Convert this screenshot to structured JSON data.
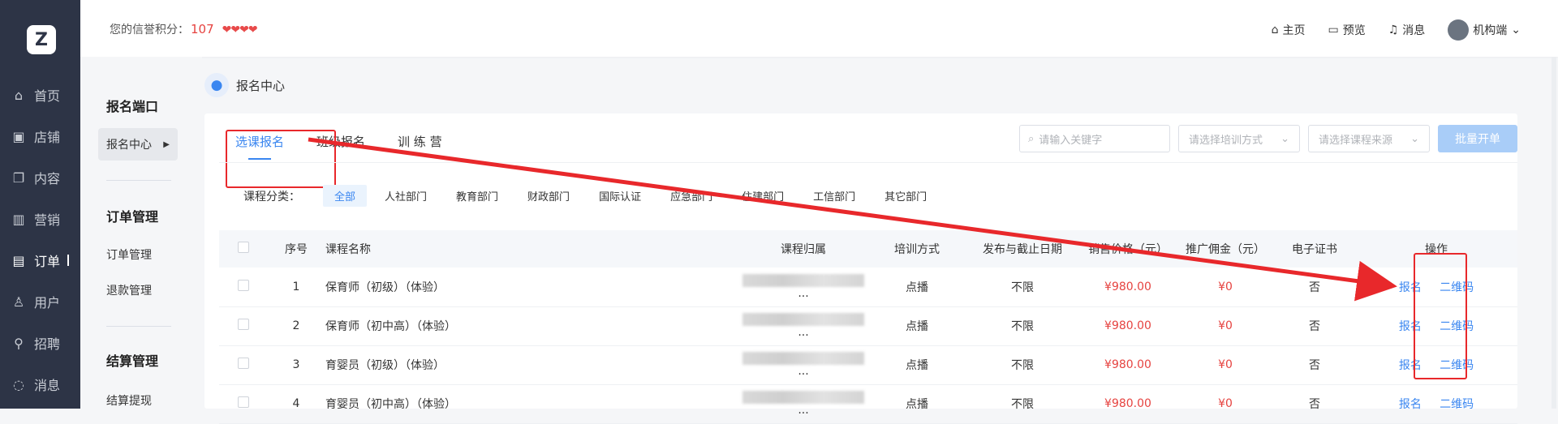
{
  "nav": {
    "logo": "Z",
    "items": [
      {
        "label": "首页",
        "icon": "⌂"
      },
      {
        "label": "店铺",
        "icon": "▣"
      },
      {
        "label": "内容",
        "icon": "❐"
      },
      {
        "label": "营销",
        "icon": "▥"
      },
      {
        "label": "订单",
        "icon": "▤"
      },
      {
        "label": "用户",
        "icon": "♙"
      },
      {
        "label": "招聘",
        "icon": "⚲"
      },
      {
        "label": "消息",
        "icon": "◌"
      }
    ]
  },
  "header": {
    "credit_label": "您的信誉积分：",
    "credit_score": "107",
    "hearts": "❤❤❤❤",
    "links": {
      "home": "主页",
      "preview": "预览",
      "messages": "消息",
      "user": "机构端"
    }
  },
  "subnav": {
    "section1": "报名端口",
    "active_item": "报名中心",
    "section2": "订单管理",
    "item_order": "订单管理",
    "item_refund": "退款管理",
    "section3": "结算管理",
    "item_withdraw": "结算提现"
  },
  "breadcrumb": "报名中心",
  "tabs": [
    "选课报名",
    "班级报名",
    "训 练 营"
  ],
  "filters": {
    "search_placeholder": "请输入关键字",
    "train_placeholder": "请选择培训方式",
    "source_placeholder": "请选择课程来源",
    "batch_button": "批量开单"
  },
  "category": {
    "label": "课程分类：",
    "items": [
      "全部",
      "人社部门",
      "教育部门",
      "财政部门",
      "国际认证",
      "应急部门",
      "住建部门",
      "工信部门",
      "其它部门"
    ]
  },
  "table": {
    "headers": [
      "序号",
      "课程名称",
      "课程归属",
      "培训方式",
      "发布与截止日期",
      "销售价格（元）",
      "推广佣金（元）",
      "电子证书",
      "操作"
    ],
    "rows": [
      {
        "no": "1",
        "name": "保育师（初级）（体验）",
        "owner_suffix": "...",
        "mode": "点播",
        "date": "不限",
        "price": "¥980.00",
        "commission": "¥0",
        "cert": "否",
        "op1": "报名",
        "op2": "二维码"
      },
      {
        "no": "2",
        "name": "保育师（初中高）（体验）",
        "owner_suffix": "...",
        "mode": "点播",
        "date": "不限",
        "price": "¥980.00",
        "commission": "¥0",
        "cert": "否",
        "op1": "报名",
        "op2": "二维码"
      },
      {
        "no": "3",
        "name": "育婴员（初级）（体验）",
        "owner_suffix": "...",
        "mode": "点播",
        "date": "不限",
        "price": "¥980.00",
        "commission": "¥0",
        "cert": "否",
        "op1": "报名",
        "op2": "二维码"
      },
      {
        "no": "4",
        "name": "育婴员（初中高）（体验）",
        "owner_suffix": "...",
        "mode": "点播",
        "date": "不限",
        "price": "¥980.00",
        "commission": "¥0",
        "cert": "否",
        "op1": "报名",
        "op2": "二维码"
      }
    ]
  },
  "colors": {
    "accent": "#3a86f0",
    "annotation": "#e8282b",
    "price": "#e64340"
  }
}
